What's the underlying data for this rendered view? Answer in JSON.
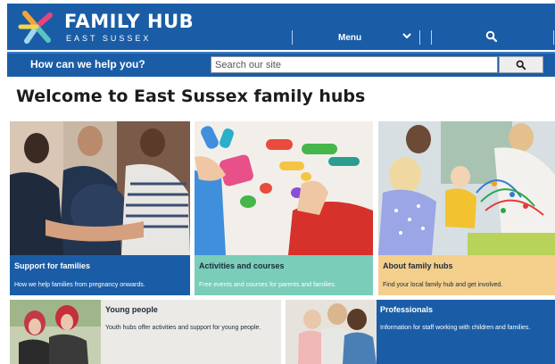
{
  "header": {
    "logo_title": "FAMILY HUB",
    "logo_subtitle": "EAST SUSSEX",
    "menu_label": "Menu",
    "icons": [
      "family-hub-logo",
      "chevron-down-icon",
      "search-icon"
    ]
  },
  "help_bar": {
    "label": "How can we help you?",
    "search_placeholder": "Search our site"
  },
  "page_title": "Welcome to East Sussex family hubs",
  "cards": [
    {
      "title": "Support for families",
      "description": "How we help families from pregnancy onwards."
    },
    {
      "title": "Activities and courses",
      "description": "Free events and courses for parents and families."
    },
    {
      "title": "About family hubs",
      "description": "Find your local family hub and get involved."
    },
    {
      "title": "Young people",
      "description": "Youth hubs offer activities and support for young people."
    },
    {
      "title": "Professionals",
      "description": "Information for staff working with children and families."
    }
  ],
  "colors": {
    "brand_blue": "#1a5da6",
    "teal": "#79cdb9",
    "peach": "#f4cf8c",
    "grey_card": "#eceae6",
    "logo_orange": "#f2a33a",
    "logo_pink": "#e8457a",
    "logo_teal": "#5cc3c4",
    "logo_cyan": "#9fd8ee"
  }
}
